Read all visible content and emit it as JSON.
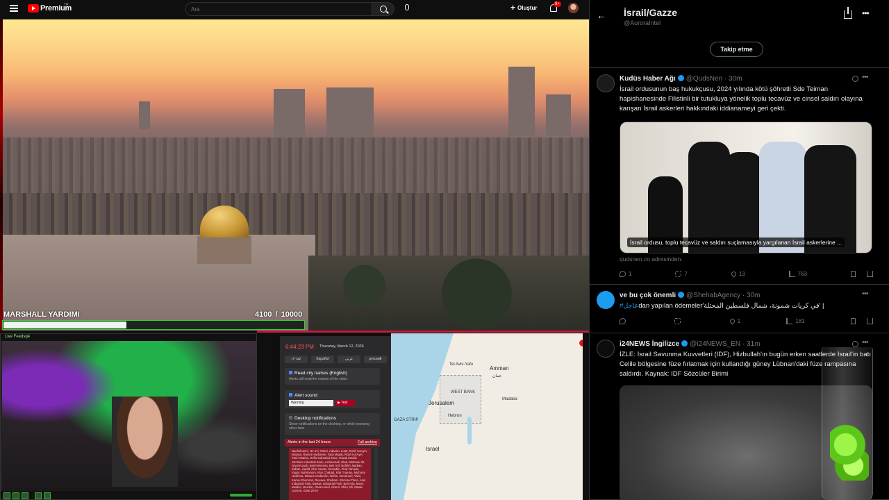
{
  "youtube": {
    "brand": "Premium",
    "brand_badge": "TR",
    "search_placeholder": "Ara",
    "create_label": "Oluştur",
    "notif_count": "9+"
  },
  "video": {
    "overlay_title": "MARSHALL YARDIMI",
    "progress_text": "4100  / 10000",
    "progress_current": 4100,
    "progress_goal": 10000
  },
  "webcam": {
    "title": "Live Feedsq4"
  },
  "alert_app": {
    "time": "6:44:23 PM",
    "date": "Thursday, March 12, 2026",
    "languages": [
      "עברית",
      "Español",
      "عربي",
      "русский"
    ],
    "settings": [
      {
        "title": "Read city names (English)",
        "desc": "Alerts will read the names of the cities",
        "checked": true
      },
      {
        "title": "Alert sound",
        "desc": "",
        "checked": true,
        "select": "Warning",
        "test_label": "▶ Test"
      },
      {
        "title": "Desktop notifications",
        "desc": "Show notifications on the desktop, or while browsing other tabs",
        "checked": false
      }
    ],
    "alerts_header": "Alerts in the last 24 hours",
    "full_archive": "Full archive",
    "alerts_text": "Nachshonim, Nir Zvi, Nitzni, Adanim, Lotat, Rosh HaAyin, Binyiya, Ramot Hashavim, Yatzi Mayat, Rosh Ha'Ayin Train Station, Zrifin Industrial Zone, Hawai Modiin Shoham Industrial Zone, Achisemah, Elad, Mishmar Ilit, Givat Koach, Beit Nehemia, Beit Arif, Nofekh, Barkan, Zafran, Hadid, Kfar Yavetz, Revadim, Tirat Yehuda, Yagal, Nahshonim, Kfar Chabad, Kfar Truman, Mishmar HaShiva, Nitzane Kedumim, Nofim, Immanuel, Yakir, Karnei Shomron, Revava, Shoham, Sha'arei Tikva, Ariel Industrial Park, Barkan Industrial Park, Beit Aria, Mevo Modiim, Bruchin, Givat Harel, Oranit, Shilo, Eli, Maale Levona, Givat Ze'ev"
  },
  "map": {
    "labels": [
      "Tel Aviv-Yafo",
      "Amman",
      "WEST BANK",
      "Jerusalem",
      "عمان",
      "GAZA STRIP",
      "Hebron",
      "Israel",
      "Madaba"
    ]
  },
  "twitter": {
    "title": "İsrail/Gazze",
    "handle": "@AuroraIntel",
    "follow_label": "Takip etme",
    "tweets": [
      {
        "name": "Kudüs Haber Ağı",
        "meta": "@QudsNen · 30m",
        "text": "İsrail ordusunun baş hukukçusu, 2024 yılında kötü şöhretli Sde Teiman hapishanesinde Filistinli bir tutukluya yönelik toplu tecavüz ve cinsel saldırı olayına karışan İsrail askerleri hakkındaki iddianameyi geri çekti.",
        "image_caption": "İsrail ordusu, toplu tecavüz ve saldırı suçlamasıyla yargılanan İsrail askerlerine ...",
        "source": "qudsnen.co adresinden.",
        "replies": "1",
        "reposts": "7",
        "likes": "13",
        "views": "763"
      },
      {
        "name": "ve bu çok önemli",
        "meta": "@ShehabAgency · 30m",
        "text_hashtag": "#عاجل",
        "text_rest": "dan yapılan ödemeler'في كريات شمونة، شمال فلسطين المحتلة' |",
        "replies": "",
        "reposts": "",
        "likes": "1",
        "views": "181"
      },
      {
        "name": "i24NEWS İngilizce",
        "meta": "@i24NEWS_EN · 31m",
        "text": "İZLE: İsrail Savunma Kuvvetleri (IDF), Hizbullah'ın bugün erken saatlerde İsrail'in batı Celile bölgesine füze fırlatmak için kullandığı güney Lübnan'daki füze rampasına saldırdı. Kaynak: IDF Sözcüler Birimi"
      }
    ]
  }
}
